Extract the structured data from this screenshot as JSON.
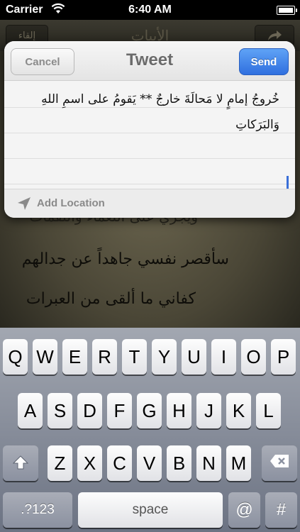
{
  "status_bar": {
    "carrier": "Carrier",
    "time": "6:40 AM"
  },
  "background_app": {
    "nav_title": "الأبيات",
    "left_button": "إلقاء",
    "right_button_icon": "share-icon",
    "poem_lines": [
      "ويجري على النعماء والنقمات",
      "سأقصر نفسي جاهداً عن جدالهم",
      "كفاني ما ألقى من العبرات"
    ]
  },
  "tweet_sheet": {
    "title": "Tweet",
    "cancel_label": "Cancel",
    "send_label": "Send",
    "text_line_1": "خُروجُ إمامٍ لا مَحالَةَ خارجٌ ** يَقومُ على اسمِ اللهِ",
    "text_line_2": "وَالبَرَكاتِ",
    "add_location_label": "Add Location",
    "location_icon": "location-arrow-icon"
  },
  "keyboard": {
    "row1": [
      "Q",
      "W",
      "E",
      "R",
      "T",
      "Y",
      "U",
      "I",
      "O",
      "P"
    ],
    "row2": [
      "A",
      "S",
      "D",
      "F",
      "G",
      "H",
      "J",
      "K",
      "L"
    ],
    "row3": [
      "Z",
      "X",
      "C",
      "V",
      "B",
      "N",
      "M"
    ],
    "numbers_label": ".?123",
    "space_label": "space",
    "at_label": "@",
    "hash_label": "#",
    "shift_icon": "shift-icon",
    "delete_icon": "delete-icon"
  }
}
